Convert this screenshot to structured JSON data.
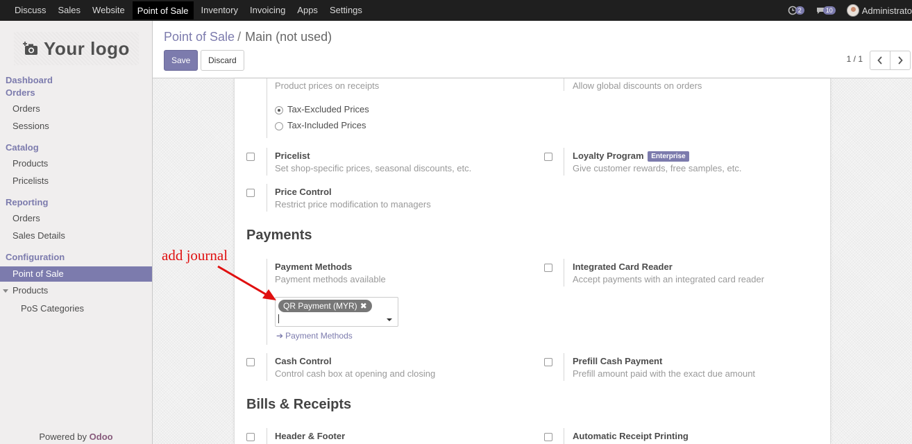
{
  "topbar": {
    "menu": [
      "Discuss",
      "Sales",
      "Website",
      "Point of Sale",
      "Inventory",
      "Invoicing",
      "Apps",
      "Settings"
    ],
    "active_index": 3,
    "activity_count": "2",
    "messages_count": "10",
    "user": "Administrato"
  },
  "sidebar": {
    "logo_text": "Your logo",
    "dashboard": "Dashboard",
    "orders_section": "Orders",
    "orders_item": "Orders",
    "sessions": "Sessions",
    "catalog": "Catalog",
    "products": "Products",
    "pricelists": "Pricelists",
    "reporting": "Reporting",
    "rep_orders": "Orders",
    "sales_details": "Sales Details",
    "configuration": "Configuration",
    "point_of_sale": "Point of Sale",
    "conf_products": "Products",
    "pos_categories": "PoS Categories",
    "powered_by": "Powered by",
    "brand": "Odoo"
  },
  "control": {
    "breadcrumb_link": "Point of Sale",
    "breadcrumb_sep": "/",
    "breadcrumb_current": "Main (not used)",
    "save": "Save",
    "discard": "Discard",
    "pager": "1 / 1"
  },
  "form": {
    "product_prices_desc": "Product prices on receipts",
    "global_discounts_desc": "Allow global discounts on orders",
    "tax_excluded": "Tax-Excluded Prices",
    "tax_included": "Tax-Included Prices",
    "pricelist_title": "Pricelist",
    "pricelist_desc": "Set shop-specific prices, seasonal discounts, etc.",
    "loyalty_title": "Loyalty Program",
    "enterprise_badge": "Enterprise",
    "loyalty_desc": "Give customer rewards, free samples, etc.",
    "price_control_title": "Price Control",
    "price_control_desc": "Restrict price modification to managers",
    "payments_section": "Payments",
    "payment_methods_title": "Payment Methods",
    "payment_methods_desc": "Payment methods available",
    "payment_tag": "QR Payment (MYR)",
    "payment_methods_link": "Payment Methods",
    "card_reader_title": "Integrated Card Reader",
    "card_reader_desc": "Accept payments with an integrated card reader",
    "cash_control_title": "Cash Control",
    "cash_control_desc": "Control cash box at opening and closing",
    "prefill_title": "Prefill Cash Payment",
    "prefill_desc": "Prefill amount paid with the exact due amount",
    "bills_section": "Bills & Receipts",
    "header_footer_title": "Header & Footer",
    "auto_print_title": "Automatic Receipt Printing"
  },
  "annotation": {
    "text": "add journal",
    "color": "#e01010"
  },
  "colors": {
    "accent": "#7c7bad",
    "navbar": "#1f1f1f"
  }
}
